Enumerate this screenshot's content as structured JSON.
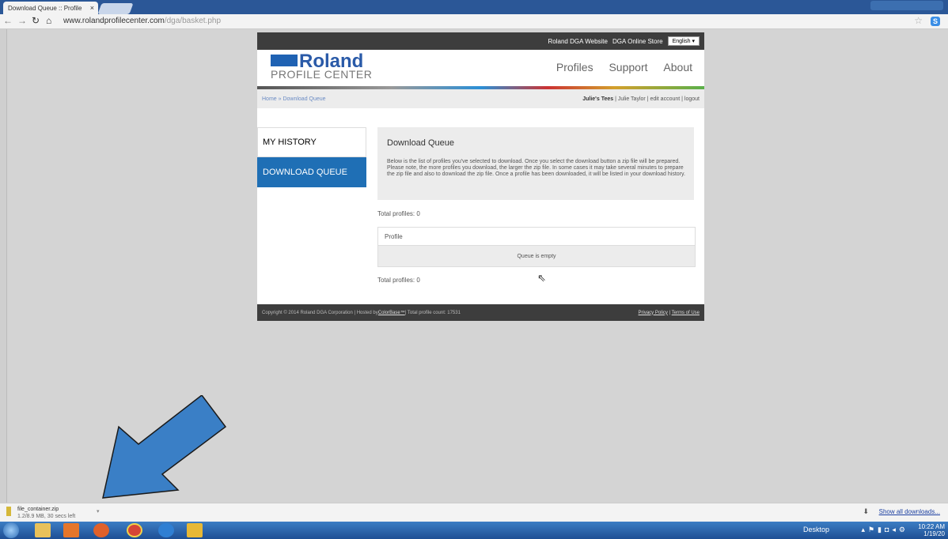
{
  "browser": {
    "tab_title": "Download Queue :: Profile",
    "tab_close": "×",
    "url_host": "www.rolandprofilecenter.com",
    "url_path": "/dga/basket.php",
    "ext_label": "S"
  },
  "site": {
    "top_links": [
      "Roland DGA Website",
      "DGA Online Store"
    ],
    "language": "English ▾",
    "logo_text": "Roland",
    "logo_sub": "PROFILE CENTER",
    "main_nav": [
      "Profiles",
      "Support",
      "About"
    ],
    "breadcrumb": "Home » Download Queue",
    "account": {
      "business": "Julie's Tees",
      "separator1": " | ",
      "user": "Julie Taylor",
      "separator2": " | ",
      "edit": "edit account",
      "separator3": " | ",
      "logout": "logout"
    },
    "sidebar": [
      {
        "label": "MY HISTORY"
      },
      {
        "label": "DOWNLOAD QUEUE"
      }
    ],
    "queue": {
      "title": "Download Queue",
      "description": "Below is the list of profiles you've selected to download. Once you select the download button a zip file will be prepared. Please note, the more profiles you download, the larger the zip file. In some cases it may take several minutes to prepare the zip file and also to download the zip file. Once a profile has been downloaded, it will be listed in your download history.",
      "total_top": "Total profiles: 0",
      "column": "Profile",
      "empty": "Queue is empty",
      "total_bottom": "Total profiles: 0"
    },
    "footer": {
      "copyright": "Copyright © 2014 Roland DGA Corporation | Hosted by ",
      "host_link": "ColorBase™",
      "count": " | Total profile count: 17531",
      "privacy": "Privacy Policy",
      "sep": " | ",
      "terms": "Terms of Use"
    }
  },
  "downloads": {
    "file_name": "file_container.zip",
    "status": "1.2/8.9 MB, 30 secs left",
    "show_all": "Show all downloads..."
  },
  "taskbar": {
    "desktop": "Desktop",
    "time": "10:22 AM",
    "date": "1/19/20"
  },
  "colors": {
    "accent": "#1f6fb5",
    "arrow": "#3a7fc6"
  }
}
